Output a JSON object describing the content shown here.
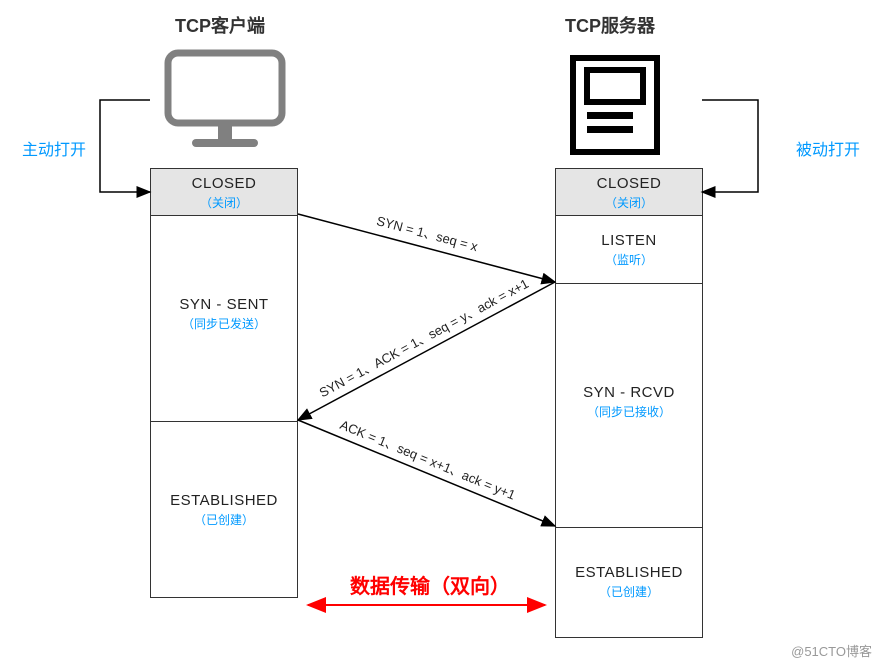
{
  "titles": {
    "client": "TCP客户端",
    "server": "TCP服务器"
  },
  "open": {
    "active": "主动打开",
    "passive": "被动打开"
  },
  "client_states": {
    "closed": {
      "t": "CLOSED",
      "s": "（关闭）"
    },
    "synsent": {
      "t": "SYN - SENT",
      "s": "（同步已发送）"
    },
    "est": {
      "t": "ESTABLISHED",
      "s": "（已创建）"
    }
  },
  "server_states": {
    "closed": {
      "t": "CLOSED",
      "s": "（关闭）"
    },
    "listen": {
      "t": "LISTEN",
      "s": "（监听）"
    },
    "synrcvd": {
      "t": "SYN - RCVD",
      "s": "（同步已接收）"
    },
    "est": {
      "t": "ESTABLISHED",
      "s": "（已创建）"
    }
  },
  "messages": {
    "m1": "SYN = 1、seq = x",
    "m2": "SYN = 1、ACK = 1、seq = y、ack = x+1",
    "m3": "ACK = 1、seq = x+1、ack = y+1"
  },
  "data_transfer": "数据传输（双向）",
  "watermark": "@51CTO博客"
}
